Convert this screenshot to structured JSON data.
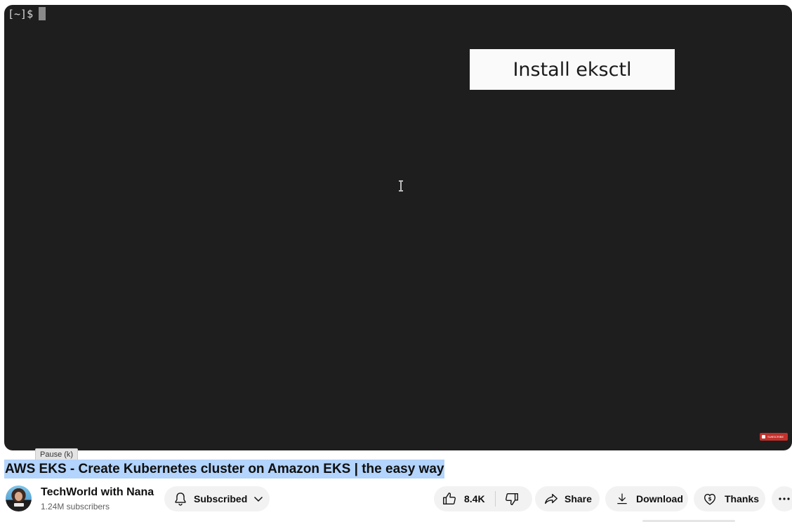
{
  "player": {
    "terminal_prompt": "[~]$",
    "overlay_text": "Install eksctl",
    "watermark_text": "SUBSCRIBE",
    "tooltip": "Pause (k)"
  },
  "video": {
    "title": "AWS EKS - Create Kubernetes cluster on Amazon EKS | the easy way"
  },
  "channel": {
    "name": "TechWorld with Nana",
    "subscribers": "1.24M subscribers"
  },
  "actions": {
    "subscribed_label": "Subscribed",
    "like_count": "8.4K",
    "share_label": "Share",
    "download_label": "Download",
    "thanks_label": "Thanks"
  },
  "colors": {
    "player_bg": "#1e1e1e",
    "title_highlight": "#b3d4fc",
    "pill_bg": "#f2f2f2",
    "watermark_red": "#c4302b"
  },
  "icons": [
    "bell-icon",
    "chevron-down-icon",
    "thumbs-up-icon",
    "thumbs-down-icon",
    "share-icon",
    "download-icon",
    "thanks-icon",
    "more-icon",
    "text-cursor-icon"
  ]
}
